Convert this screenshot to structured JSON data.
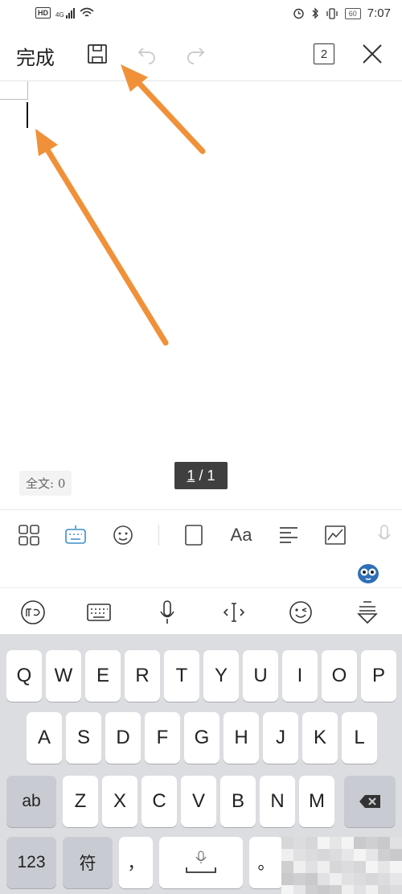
{
  "status": {
    "network": "4G",
    "battery": "60",
    "time": "7:07"
  },
  "toolbar": {
    "done_label": "完成",
    "page_count": "2"
  },
  "document": {
    "word_count": "全文: 0",
    "page_current": "1",
    "page_total": "/ 1"
  },
  "keyboard": {
    "row1": [
      "Q",
      "W",
      "E",
      "R",
      "T",
      "Y",
      "U",
      "I",
      "O",
      "P"
    ],
    "row2": [
      "A",
      "S",
      "D",
      "F",
      "G",
      "H",
      "J",
      "K",
      "L"
    ],
    "row3": [
      "Z",
      "X",
      "C",
      "V",
      "B",
      "N",
      "M"
    ],
    "shift_label": "ab",
    "num_label": "123",
    "symbol_label": "符",
    "comma_label": "，",
    "period_label": "。"
  },
  "colors": {
    "accent": "#3d8fc9",
    "keyboard_bg": "#dcdde1",
    "annotation_arrow": "#f0913a"
  }
}
